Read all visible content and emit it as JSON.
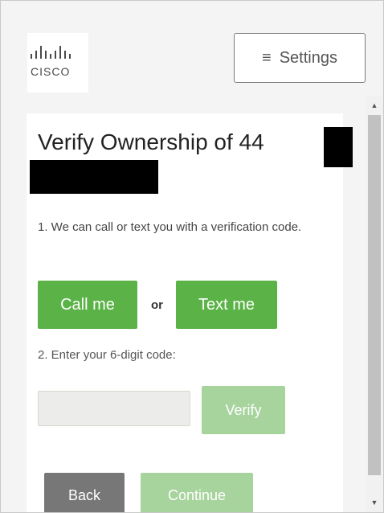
{
  "header": {
    "logo_text": "CISCO",
    "settings_label": "Settings"
  },
  "verify": {
    "title": "Verify Ownership of 44",
    "step1": "1. We can call or text you with a verification code.",
    "call_label": "Call me",
    "or_label": "or",
    "text_label": "Text me",
    "step2": "2. Enter your 6-digit code:",
    "code_value": "",
    "verify_label": "Verify",
    "back_label": "Back",
    "continue_label": "Continue"
  },
  "colors": {
    "green": "#5bb347",
    "green_disabled": "#a7d39d",
    "gray_button": "#777777"
  },
  "icons": {
    "menu": "hamburger-icon",
    "scroll_up": "arrow-up-icon",
    "scroll_down": "arrow-down-icon"
  }
}
